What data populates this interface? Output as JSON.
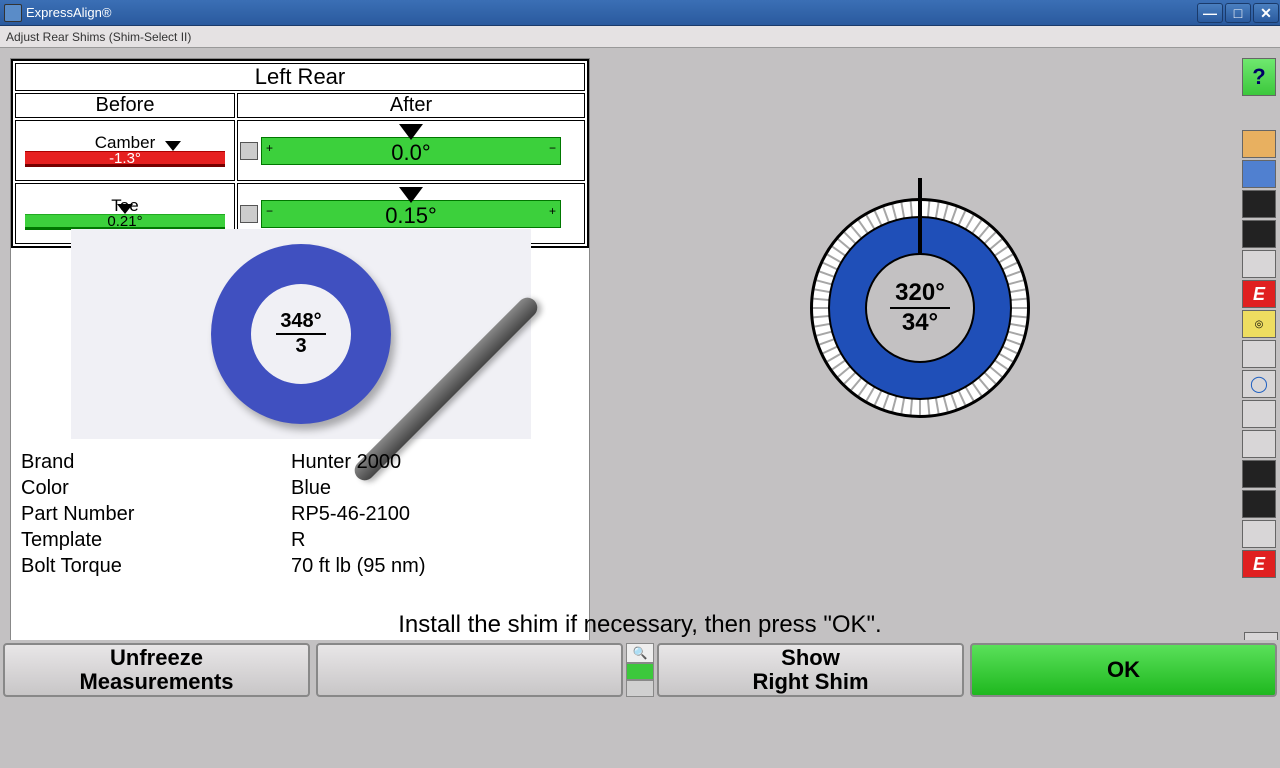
{
  "titlebar": {
    "title": "ExpressAlign®"
  },
  "menubar": {
    "text": "Adjust Rear Shims   (Shim-Select II)"
  },
  "readings": {
    "header": "Left Rear",
    "before_label": "Before",
    "after_label": "After",
    "camber_label": "Camber",
    "toe_label": "Toe",
    "before": {
      "camber": "-1.3°",
      "toe": "0.21°"
    },
    "after": {
      "camber": "0.0°",
      "toe": "0.15°"
    }
  },
  "photo": {
    "angle": "348°",
    "count": "3"
  },
  "info": {
    "brand_label": "Brand",
    "brand": "Hunter 2000",
    "color_label": "Color",
    "color": "Blue",
    "partnum_label": "Part Number",
    "partnum": "RP5-46-2100",
    "template_label": "Template",
    "template": "R",
    "torque_label": "Bolt Torque",
    "torque": "70 ft lb (95 nm)"
  },
  "diagram": {
    "top_value": "320°",
    "bottom_value": "34°"
  },
  "instruction": "Install the shim if necessary, then press \"OK\".",
  "buttons": {
    "unfreeze": "Unfreeze\nMeasurements",
    "show_right": "Show\nRight Shim",
    "ok": "OK"
  }
}
